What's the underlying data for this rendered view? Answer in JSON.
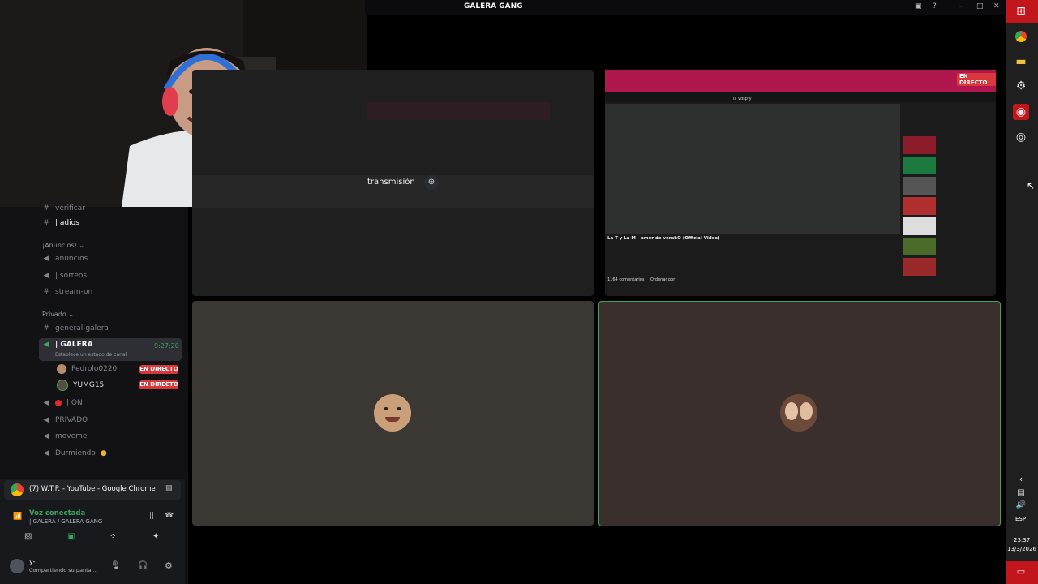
{
  "window": {
    "title": "GALERA GANG"
  },
  "webcam_overlay": {
    "label": "webcam feed of streamer"
  },
  "stream_left": {
    "transmit_label": "transmisión"
  },
  "stream_right": {
    "live_badge": "EN DIRECTO",
    "video_title": "La T y La M - amor de verabO (Official Video)",
    "comments_count": "1164 comentarios",
    "sort_label": "Ordenar por",
    "search_text": "la vdsp/y"
  },
  "sidebar": {
    "channels_top": [
      {
        "icon": "#",
        "name": "verificar"
      },
      {
        "icon": "#",
        "name": "| adios"
      }
    ],
    "category_announcements": "¡Anuncios!",
    "announcement_channels": [
      {
        "name": "anuncios"
      },
      {
        "name": "| sorteos"
      },
      {
        "name": "stream-on"
      }
    ],
    "category_private": "Privado",
    "private_text_channel": "general-galera",
    "voice_channel": {
      "name": "| GALERA",
      "timer": "9:27:20",
      "status_prompt": "Establece un estado de canal"
    },
    "voice_members": [
      {
        "name": "Pedrolo0220",
        "badge": "EN DIRECTO"
      },
      {
        "name": "YUMG15",
        "badge": "EN DIRECTO"
      }
    ],
    "other_voice_channels": [
      {
        "name": "| ON"
      },
      {
        "name": "PRIVADO"
      },
      {
        "name": "moveme"
      },
      {
        "name": "Durmiendo"
      }
    ]
  },
  "voice_panel": {
    "activity": "(7) W.T.P. - YouTube - Google Chrome",
    "status": "Voz conectada",
    "location": "| GALERA / GALERA GANG",
    "user_name": "y-",
    "user_status": "Compartiendo su panta..."
  },
  "taskbar": {
    "language": "ESP",
    "time": "23:37",
    "date": "13/3/2026"
  },
  "colors": {
    "live": "#da373c",
    "connected": "#3ba55d",
    "accent": "#5865f2"
  }
}
